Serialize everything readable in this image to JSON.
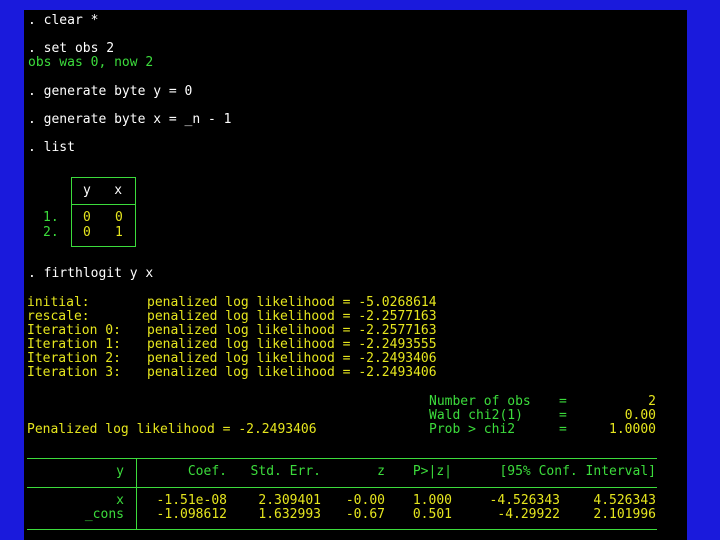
{
  "commands": {
    "clear": ". clear *",
    "set_obs": ". set obs 2",
    "set_obs_result": "obs was 0, now 2",
    "gen_y": ". generate byte y = 0",
    "gen_x": ". generate byte x = _n - 1",
    "list": ". list",
    "firthlogit": ". firthlogit y x"
  },
  "list_table": {
    "header": "y   x",
    "rows": [
      {
        "idx": "1.",
        "y": "0",
        "x": "0"
      },
      {
        "idx": "2.",
        "y": "0",
        "x": "1"
      }
    ]
  },
  "iterations": [
    {
      "label": "initial:",
      "text": "penalized log likelihood = -5.0268614"
    },
    {
      "label": "rescale:",
      "text": "penalized log likelihood = -2.2577163"
    },
    {
      "label": "Iteration 0:",
      "text": "penalized log likelihood = -2.2577163"
    },
    {
      "label": "Iteration 1:",
      "text": "penalized log likelihood = -2.2493555"
    },
    {
      "label": "Iteration 2:",
      "text": "penalized log likelihood = -2.2493406"
    },
    {
      "label": "Iteration 3:",
      "text": "penalized log likelihood = -2.2493406"
    }
  ],
  "stats": [
    {
      "label": "Number of obs",
      "eq": "=",
      "value": "2"
    },
    {
      "label": "Wald chi2(1)",
      "eq": "=",
      "value": "0.00"
    },
    {
      "label": "Prob > chi2",
      "eq": "=",
      "value": "1.0000"
    }
  ],
  "penalized_ll": "Penalized log likelihood = -2.2493406",
  "reg_table": {
    "depvar": "y",
    "headers": [
      "Coef.",
      "Std. Err.",
      "z",
      "P>|z|",
      "[95% Conf. Interval]"
    ],
    "rows": [
      {
        "name": "x",
        "coef": "-1.51e-08",
        "se": "2.309401",
        "z": "-0.00",
        "p": "1.000",
        "lo": "-4.526343",
        "hi": "4.526343"
      },
      {
        "name": "_cons",
        "coef": "-1.098612",
        "se": "1.632993",
        "z": "-0.67",
        "p": "0.501",
        "lo": "-4.29922",
        "hi": "2.101996"
      }
    ]
  }
}
